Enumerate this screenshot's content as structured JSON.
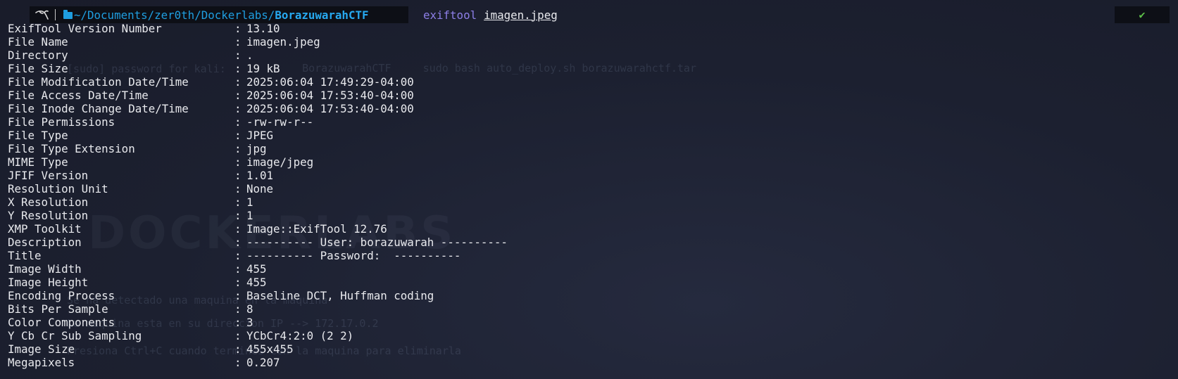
{
  "prompt": {
    "os_icon": "kali-dragon-icon",
    "folder_icon": "folder-open-icon",
    "path_dir": "~/Documents/zer0th/Dockerlabs/",
    "path_base": "BorazuwarahCTF",
    "command": "exiftool",
    "argument": "imagen.jpeg",
    "status_icon": "check-icon",
    "status_glyph": "✔",
    "status_color": "#5ec24a"
  },
  "colors": {
    "background": "#1c2030",
    "path": "#1f9ee0",
    "command": "#8d7fe8",
    "text": "#e9eaee"
  },
  "output": [
    {
      "key": "ExifTool Version Number",
      "value": "13.10"
    },
    {
      "key": "File Name",
      "value": "imagen.jpeg"
    },
    {
      "key": "Directory",
      "value": "."
    },
    {
      "key": "File Size",
      "value": "19 kB"
    },
    {
      "key": "File Modification Date/Time",
      "value": "2025:06:04 17:49:29-04:00"
    },
    {
      "key": "File Access Date/Time",
      "value": "2025:06:04 17:53:40-04:00"
    },
    {
      "key": "File Inode Change Date/Time",
      "value": "2025:06:04 17:53:40-04:00"
    },
    {
      "key": "File Permissions",
      "value": "-rw-rw-r--"
    },
    {
      "key": "File Type",
      "value": "JPEG"
    },
    {
      "key": "File Type Extension",
      "value": "jpg"
    },
    {
      "key": "MIME Type",
      "value": "image/jpeg"
    },
    {
      "key": "JFIF Version",
      "value": "1.01"
    },
    {
      "key": "Resolution Unit",
      "value": "None"
    },
    {
      "key": "X Resolution",
      "value": "1"
    },
    {
      "key": "Y Resolution",
      "value": "1"
    },
    {
      "key": "XMP Toolkit",
      "value": "Image::ExifTool 12.76"
    },
    {
      "key": "Description",
      "value": "---------- User: borazuwarah ----------"
    },
    {
      "key": "Title",
      "value": "---------- Password:  ----------"
    },
    {
      "key": "Image Width",
      "value": "455"
    },
    {
      "key": "Image Height",
      "value": "455"
    },
    {
      "key": "Encoding Process",
      "value": "Baseline DCT, Huffman coding"
    },
    {
      "key": "Bits Per Sample",
      "value": "8"
    },
    {
      "key": "Color Components",
      "value": "3"
    },
    {
      "key": "Y Cb Cr Sub Sampling",
      "value": "YCbCr4:2:0 (2 2)"
    },
    {
      "key": "Image Size",
      "value": "455x455"
    },
    {
      "key": "Megapixels",
      "value": "0.207"
    }
  ],
  "background_ghost": {
    "line1_prefix": "BorazuwarahCTF",
    "line1_cmd": "sudo bash auto_deploy.sh borazuwarahctf.tar",
    "line2": "[sudo] password for kali:",
    "line3": "Se ha detectado una maquina en la maquina",
    "line4": "La maquina esta en su direccion IP --> 172.17.0.2",
    "line5": "Presiona Ctrl+C cuando termines con la maquina para eliminarla",
    "logo": "DOCKERLABS"
  }
}
